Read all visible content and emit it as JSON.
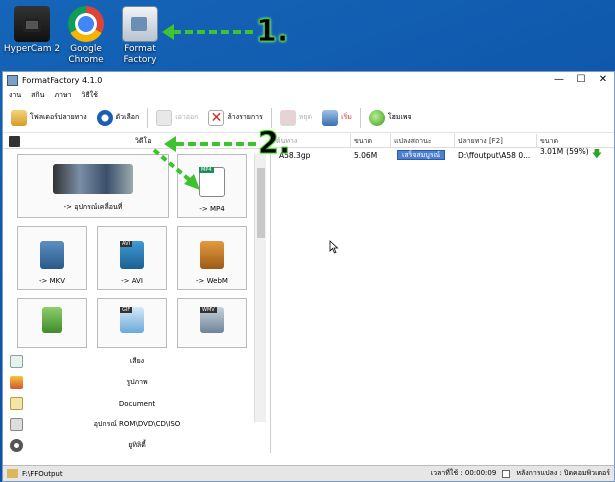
{
  "desktop": {
    "icons": [
      {
        "label": "HyperCam 2"
      },
      {
        "label": "Google Chrome"
      },
      {
        "label": "Format Factory"
      }
    ],
    "callouts": [
      "1.",
      "2."
    ]
  },
  "window": {
    "title": "FormatFactory 4.1.0",
    "controls": [
      "—",
      "☐",
      "✕"
    ]
  },
  "menu": [
    "งาน",
    "สกิน",
    "ภาษา",
    "วิธีใช้"
  ],
  "toolbar": {
    "output_folder": "โฟลเดอร์ปลายทาง",
    "options": "ตัวเลือก",
    "remove": "เอาออก",
    "clear_list": "ล้างรายการ",
    "stop": "หยุด",
    "start": "เริ่ม",
    "homepage": "โฮมเพจ"
  },
  "left_pane": {
    "category_header": "วิดีโอ",
    "tiles": [
      {
        "label": "-> อุปกรณ์เคลื่อนที่"
      },
      {
        "label": "-> MP4",
        "badge": "MP4"
      },
      {
        "label": "-> MKV"
      },
      {
        "label": "-> AVI",
        "badge": "AVI"
      },
      {
        "label": "-> WebM"
      },
      {
        "label": "",
        "badge": ""
      },
      {
        "label": "",
        "badge": "GIF"
      },
      {
        "label": "",
        "badge": "WMV"
      }
    ],
    "categories": [
      {
        "label": "เสียง"
      },
      {
        "label": "รูปภาพ"
      },
      {
        "label": "Document"
      },
      {
        "label": "อุปกรณ์ ROM\\DVD\\CD\\ISO"
      },
      {
        "label": "ยูทิลิตี้"
      }
    ]
  },
  "task_table": {
    "headers": [
      "ต้นทาง",
      "ขนาด",
      "แปลงสถานะ",
      "ปลายทาง [F2]",
      "ขนาด"
    ],
    "rows": [
      {
        "source": "A58.3gp",
        "size": "5.06M",
        "status": "เสร็จสมบูรณ์",
        "output": "D:\\ffoutput\\A58 0...",
        "out_size": "3.01M",
        "ratio": "(59%)"
      }
    ]
  },
  "statusbar": {
    "folder": "F:\\FFOutput",
    "elapsed": "เวลาที่ใช้ : 00:00:09",
    "after_convert": "หลังการแปลง : ปิดคอมพิวเตอร์"
  },
  "colors": {
    "desktop_bg": "#1565b8",
    "callout_green": "#3ec22d",
    "status_blue": "#4b7fd1"
  }
}
